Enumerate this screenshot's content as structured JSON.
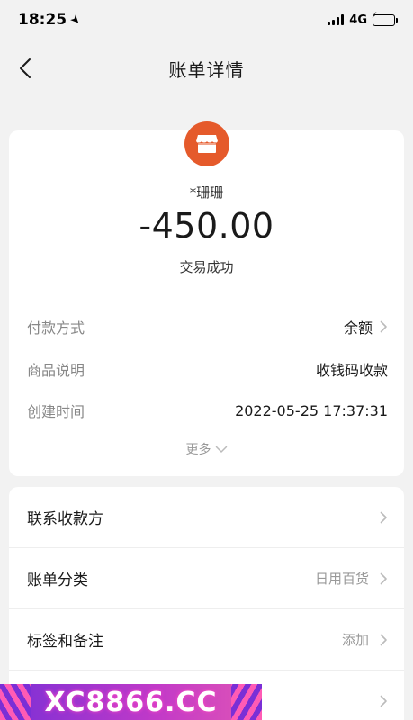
{
  "status_bar": {
    "time": "18:25",
    "network": "4G"
  },
  "nav": {
    "title": "账单详情"
  },
  "summary": {
    "payee": "*珊珊",
    "amount": "-450.00",
    "status": "交易成功",
    "icon": "shop-icon",
    "icon_color": "#e55a2b"
  },
  "details": [
    {
      "label": "付款方式",
      "value": "余额"
    },
    {
      "label": "商品说明",
      "value": "收钱码收款"
    },
    {
      "label": "创建时间",
      "value": "2022-05-25 17:37:31"
    }
  ],
  "more_label": "更多",
  "actions": [
    {
      "label": "联系收款方",
      "value": ""
    },
    {
      "label": "账单分类",
      "value": "日用百货"
    },
    {
      "label": "标签和备注",
      "value": "添加"
    }
  ],
  "watermark": "XC8866.CC"
}
